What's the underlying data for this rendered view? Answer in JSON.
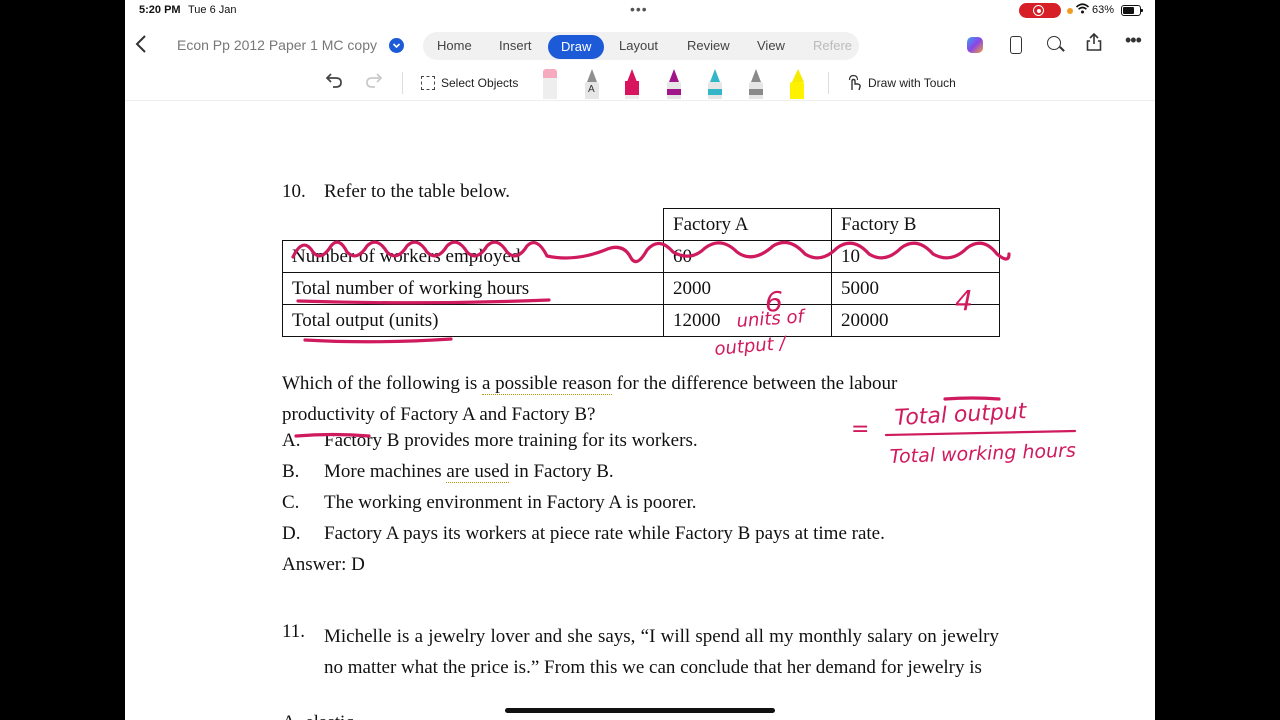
{
  "status_bar": {
    "time": "5:20 PM",
    "date": "Tue 6 Jan",
    "battery": "63%"
  },
  "title_bar": {
    "document_title": "Econ Pp 2012 Paper 1 MC copy",
    "tabs": [
      {
        "label": "Home"
      },
      {
        "label": "Insert"
      },
      {
        "label": "Draw",
        "active": true
      },
      {
        "label": "Layout"
      },
      {
        "label": "Review"
      },
      {
        "label": "View"
      },
      {
        "label": "Refere"
      }
    ]
  },
  "draw_toolbar": {
    "select_label": "Select Objects",
    "draw_touch_label": "Draw with Touch",
    "pens": [
      {
        "name": "eraser",
        "color": "#f6a9bf"
      },
      {
        "name": "pencil",
        "color": "#8f8f8f"
      },
      {
        "name": "pen",
        "color": "#d8145f"
      },
      {
        "name": "pen",
        "color": "#a0168a"
      },
      {
        "name": "pen",
        "color": "#33b6c8"
      },
      {
        "name": "pen",
        "color": "#8a8a8a"
      },
      {
        "name": "highlighter",
        "color": "#fff200"
      }
    ]
  },
  "document": {
    "q10": {
      "number": "10.",
      "stem": "Refer to the table below.",
      "table": {
        "headers": [
          "",
          "Factory A",
          "Factory B"
        ],
        "rows": [
          [
            "Number of workers employed",
            "60",
            "10"
          ],
          [
            "Total number of working hours",
            "2000",
            "5000"
          ],
          [
            "Total output (units)",
            "12000",
            "20000"
          ]
        ]
      },
      "question_line1": {
        "pre": "Which of the following is ",
        "dotted": "a possible reason",
        "post": " for the difference between the labour"
      },
      "question_line2": "productivity of Factory A and Factory B?",
      "options": [
        {
          "letter": "A.",
          "pre": "Factory B provides more training for its workers.",
          "dotted": "",
          "post": ""
        },
        {
          "letter": "B.",
          "pre": "More machines ",
          "dotted": "are used",
          "post": " in Factory B."
        },
        {
          "letter": "C.",
          "pre": "The working environment in Factory A is poorer.",
          "dotted": "",
          "post": ""
        },
        {
          "letter": "D.",
          "pre": "Factory A pays its workers at piece rate while Factory B pays at time rate.",
          "dotted": "",
          "post": ""
        }
      ],
      "answer": "Answer: D"
    },
    "q11": {
      "number": "11.",
      "text": "Michelle is a jewelry lover and she says, “I will spend all my monthly salary on jewelry no matter what the price is.” From this we can conclude that her demand for jewelry is",
      "cut_off_line": "A.    elastic"
    }
  },
  "ink": {
    "color": "#d01a5e",
    "note_a_value": "6",
    "note_b_value": "4",
    "note_units": "units of output /",
    "formula_numerator": "Total output",
    "formula_denominator": "Total working hours",
    "formula_eq": "="
  }
}
